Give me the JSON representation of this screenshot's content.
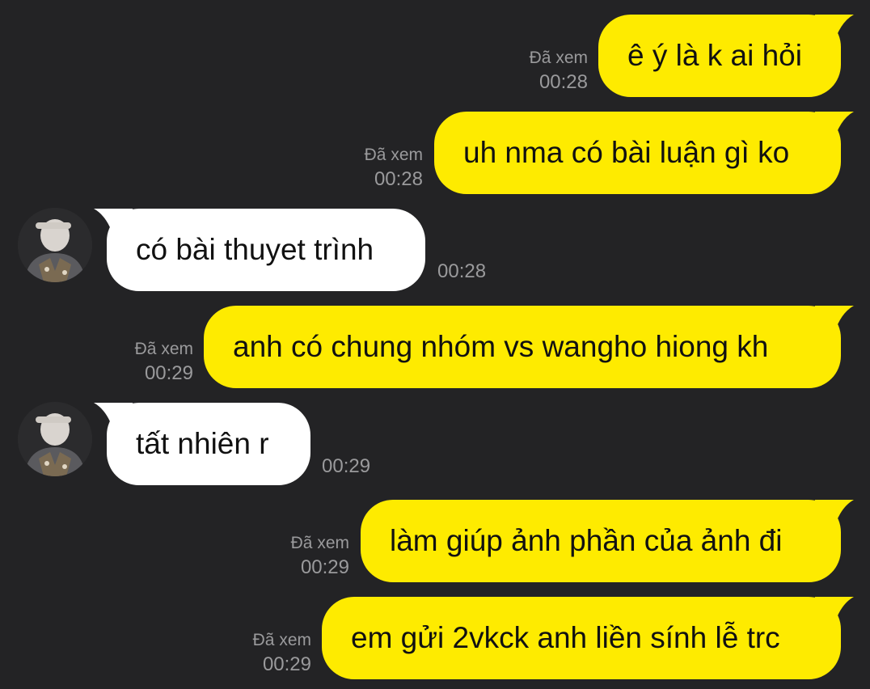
{
  "colors": {
    "background": "#232325",
    "sent_bubble": "#FEEB00",
    "received_bubble": "#FFFFFF",
    "meta_text": "#9A9A9C"
  },
  "messages": [
    {
      "direction": "sent",
      "text": "ê ý là k ai hỏi",
      "read": "Đã xem",
      "time": "00:28"
    },
    {
      "direction": "sent",
      "text": "uh nma có bài luận gì ko",
      "read": "Đã xem",
      "time": "00:28"
    },
    {
      "direction": "received",
      "text": "có bài thuyet trình",
      "time": "00:28",
      "avatar_icon": "user-avatar"
    },
    {
      "direction": "sent",
      "text": "anh có chung nhóm vs wangho hiong kh",
      "read": "Đã xem",
      "time": "00:29"
    },
    {
      "direction": "received",
      "text": "tất nhiên r",
      "time": "00:29",
      "avatar_icon": "user-avatar"
    },
    {
      "direction": "sent",
      "text": "làm giúp ảnh phần của ảnh đi",
      "read": "Đã xem",
      "time": "00:29"
    },
    {
      "direction": "sent",
      "text": "em gửi 2vkck anh liền sính lễ trc",
      "read": "Đã xem",
      "time": "00:29"
    }
  ]
}
